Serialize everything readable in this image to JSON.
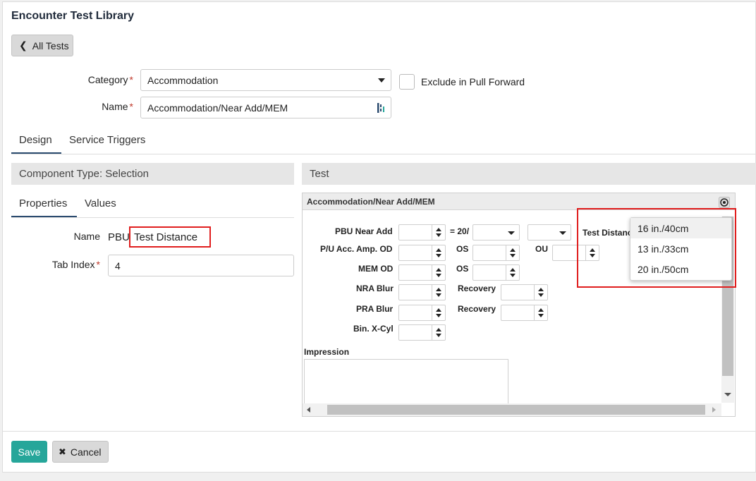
{
  "app": {
    "title": "Encounter Test Library"
  },
  "back_button": {
    "label": "All Tests"
  },
  "form": {
    "category_label": "Category",
    "category_value": "Accommodation",
    "exclude_label": "Exclude in Pull Forward",
    "name_label": "Name",
    "name_value": "Accommodation/Near Add/MEM"
  },
  "tabs": [
    {
      "label": "Design",
      "active": true
    },
    {
      "label": "Service Triggers",
      "active": false
    }
  ],
  "left_panel": {
    "header": "Component Type: Selection",
    "tabs": [
      {
        "label": "Properties",
        "active": true
      },
      {
        "label": "Values",
        "active": false
      }
    ],
    "name_label": "Name",
    "name_prefix": "PBU",
    "name_value": "Test Distance",
    "tab_index_label": "Tab Index",
    "tab_index_value": "4"
  },
  "right_panel": {
    "header": "Test",
    "preview_title": "Accommodation/Near Add/MEM",
    "labels": {
      "pbu_near_add": "PBU Near Add",
      "eq20": "= 20/",
      "test_distance": "Test Distance",
      "pu_acc_amp_od": "P/U Acc. Amp. OD",
      "os": "OS",
      "ou": "OU",
      "mem_od": "MEM OD",
      "nra_blur": "NRA Blur",
      "recovery": "Recovery",
      "pra_blur": "PRA Blur",
      "bin_xcyl": "Bin. X-Cyl",
      "impression": "Impression"
    },
    "distance_options": [
      "16 in./40cm",
      "13 in./33cm",
      "20 in./50cm"
    ]
  },
  "footer": {
    "save_label": "Save",
    "cancel_label": "Cancel"
  },
  "colors": {
    "accent": "#26a69a",
    "highlight": "#e01e1e",
    "required": "#c0392b"
  }
}
